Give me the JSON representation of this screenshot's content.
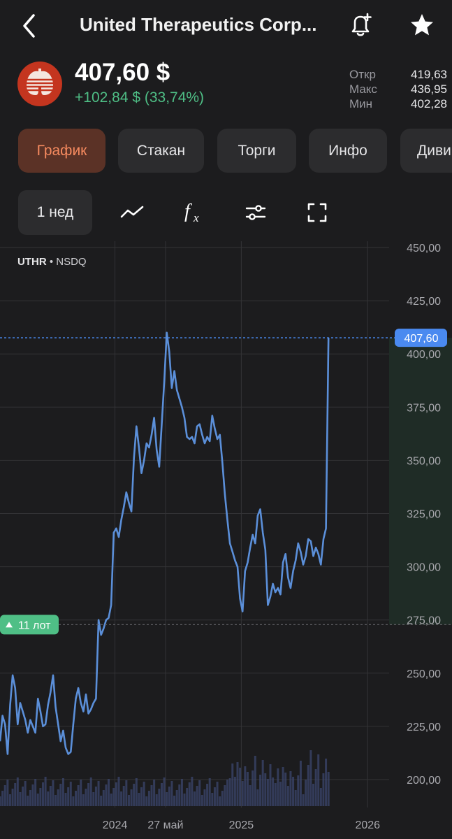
{
  "header": {
    "title": "United Therapeutics Corp...",
    "icons": {
      "back": "chevron-left-icon",
      "alert": "bell-plus-icon",
      "favorite": "star-icon"
    }
  },
  "quote": {
    "price": "407,60 $",
    "change": "+102,84 $ (33,74%)",
    "change_color": "#4fbf86",
    "stats": [
      {
        "label": "Откр",
        "value": "419,63"
      },
      {
        "label": "Макс",
        "value": "436,95"
      },
      {
        "label": "Мин",
        "value": "402,28"
      }
    ]
  },
  "tabs": [
    {
      "label": "График",
      "active": true
    },
    {
      "label": "Стакан",
      "active": false
    },
    {
      "label": "Торги",
      "active": false
    },
    {
      "label": "Инфо",
      "active": false
    },
    {
      "label": "Диви",
      "active": false
    }
  ],
  "toolbar": {
    "period": "1 нед",
    "icons": [
      "line-chart-icon",
      "function-icon",
      "settings-sliders-icon",
      "fullscreen-icon"
    ]
  },
  "chart_data": {
    "type": "line",
    "ticker": "UTHR",
    "exchange": "NSDQ",
    "line_color": "#5b8fd9",
    "accent_color": "#4a8af0",
    "lots_color": "#4fbf86",
    "y_ticks": [
      "450,00",
      "425,00",
      "400,00",
      "375,00",
      "350,00",
      "325,00",
      "300,00",
      "275,00",
      "250,00",
      "225,00",
      "200,00"
    ],
    "ylim": [
      190,
      450
    ],
    "x_labels": [
      {
        "label": "2024",
        "x": 2024.0
      },
      {
        "label": "27 май",
        "x": 2024.4
      },
      {
        "label": "2025",
        "x": 2025.0
      },
      {
        "label": "2026",
        "x": 2026.0
      }
    ],
    "xlim": [
      2023.09,
      2026.17
    ],
    "current_price": 407.6,
    "current_price_label": "407,60",
    "lots_label": "11 лот",
    "lots_price": 272.8,
    "series": [
      {
        "x": [
          2023.09,
          2023.11,
          2023.13,
          2023.15,
          2023.17,
          2023.19,
          2023.21,
          2023.23,
          2023.25,
          2023.27,
          2023.29,
          2023.31,
          2023.33,
          2023.35,
          2023.37,
          2023.39,
          2023.41,
          2023.43,
          2023.45,
          2023.47,
          2023.49,
          2023.51,
          2023.53,
          2023.55,
          2023.57,
          2023.59,
          2023.61,
          2023.63,
          2023.65,
          2023.67,
          2023.69,
          2023.71,
          2023.73,
          2023.75,
          2023.77,
          2023.79,
          2023.81,
          2023.83,
          2023.85,
          2023.87,
          2023.89,
          2023.91,
          2023.93,
          2023.95,
          2023.97,
          2023.99,
          2024.01,
          2024.03,
          2024.05,
          2024.07,
          2024.09,
          2024.11,
          2024.13,
          2024.15,
          2024.17,
          2024.19,
          2024.21,
          2024.23,
          2024.25,
          2024.27,
          2024.29,
          2024.31,
          2024.33,
          2024.35,
          2024.37,
          2024.39,
          2024.41,
          2024.43,
          2024.45,
          2024.47,
          2024.49,
          2024.51,
          2024.53,
          2024.55,
          2024.57,
          2024.59,
          2024.61,
          2024.63,
          2024.65,
          2024.67,
          2024.69,
          2024.71,
          2024.73,
          2024.75,
          2024.77,
          2024.79,
          2024.81,
          2024.83,
          2024.85,
          2024.87,
          2024.89,
          2024.91,
          2024.93,
          2024.95,
          2024.97,
          2024.99,
          2025.01,
          2025.03,
          2025.05,
          2025.07,
          2025.09,
          2025.11,
          2025.13,
          2025.15,
          2025.17,
          2025.19,
          2025.21,
          2025.23,
          2025.25,
          2025.27,
          2025.29,
          2025.31,
          2025.33,
          2025.35,
          2025.37,
          2025.39,
          2025.41,
          2025.43,
          2025.45,
          2025.47,
          2025.49,
          2025.51,
          2025.53,
          2025.55,
          2025.57,
          2025.59,
          2025.61,
          2025.63,
          2025.65,
          2025.67,
          2025.69,
          2025.71,
          2025.73,
          2025.75
        ],
        "y": [
          218,
          230,
          226,
          212,
          235,
          249,
          243,
          226,
          236,
          232,
          228,
          222,
          228,
          225,
          222,
          238,
          232,
          225,
          226,
          235,
          241,
          249,
          234,
          226,
          218,
          223,
          215,
          212,
          213,
          226,
          238,
          243,
          236,
          232,
          240,
          231,
          233,
          236,
          238,
          275,
          268,
          271,
          275,
          276,
          282,
          316,
          318,
          314,
          322,
          328,
          335,
          330,
          326,
          351,
          366,
          356,
          344,
          350,
          358,
          356,
          362,
          370,
          355,
          347,
          367,
          387,
          410,
          401,
          384,
          392,
          383,
          379,
          375,
          370,
          361,
          360,
          361,
          358,
          366,
          367,
          362,
          358,
          361,
          359,
          371,
          365,
          360,
          362,
          349,
          334,
          322,
          311,
          307,
          303,
          300,
          285,
          279,
          298,
          302,
          309,
          315,
          311,
          324,
          327,
          316,
          308,
          282,
          286,
          292,
          288,
          290,
          287,
          302,
          306,
          295,
          290,
          298,
          303,
          311,
          307,
          301,
          305,
          313,
          312,
          305,
          309,
          306,
          301,
          313,
          318,
          407.6,
          407.6,
          407.6,
          407.6
        ]
      }
    ]
  }
}
